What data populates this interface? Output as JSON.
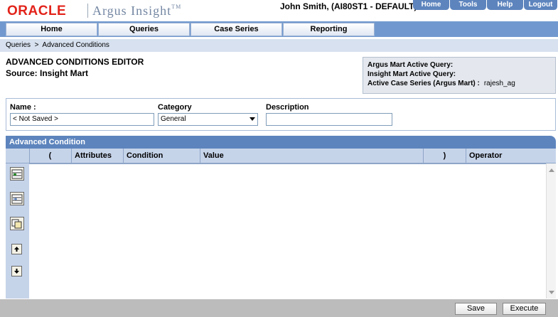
{
  "app": {
    "logo": "ORACLE",
    "product": "Argus Insight",
    "trademark": "TM",
    "user": "John Smith,  (AI80ST1 - DEFAULT)"
  },
  "top_links": [
    "Home",
    "Tools",
    "Help",
    "Logout"
  ],
  "nav_tabs": [
    "Home",
    "Queries",
    "Case Series",
    "Reporting"
  ],
  "breadcrumb": "Queries  >  Advanced Conditions",
  "page": {
    "title": "ADVANCED CONDITIONS EDITOR",
    "source": "Source: Insight Mart"
  },
  "active_info": {
    "argus_mart_label": "Argus Mart Active Query:",
    "insight_mart_label": "Insight Mart Active Query:",
    "case_series_label": "Active Case Series (Argus Mart) :",
    "case_series_value": "rajesh_ag"
  },
  "form": {
    "name_label": "Name :",
    "name_value": "< Not Saved >",
    "category_label": "Category",
    "category_value": "General",
    "description_label": "Description",
    "description_value": ""
  },
  "advanced_condition": {
    "header": "Advanced Condition",
    "columns": [
      "(",
      "Attributes",
      "Condition",
      "Value",
      ")",
      "Operator"
    ]
  },
  "toolbar_icons": [
    "add-row-icon",
    "insert-row-icon",
    "copy-row-icon",
    "move-up-icon",
    "move-down-icon"
  ],
  "footer": {
    "save_label": "Save",
    "execute_label": "Execute"
  },
  "colors": {
    "oracle_red": "#e2231a",
    "nav_blue": "#7199cf",
    "panel_header_blue": "#5d84bd",
    "column_header_bg": "#c6d4ea"
  }
}
